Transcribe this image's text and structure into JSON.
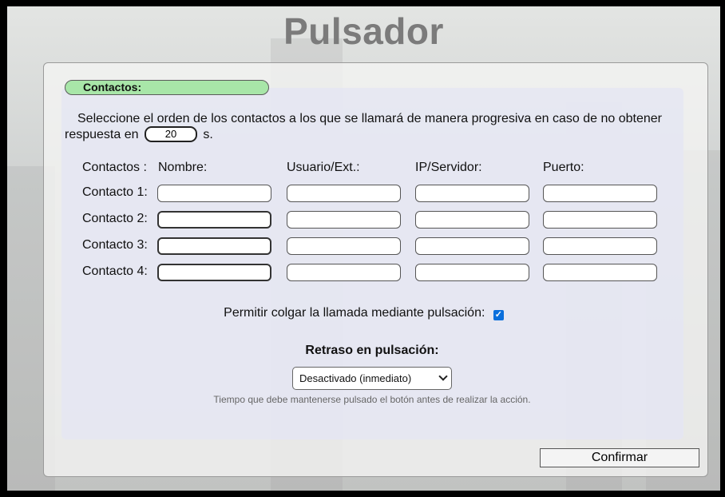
{
  "page": {
    "title": "Pulsador"
  },
  "contacts": {
    "section_label": "Contactos:",
    "intro_before": "Seleccione el orden de los contactos a los que se llamará de manera progresiva en caso de no obtener respuesta en",
    "timeout_value": "20",
    "intro_after": "s.",
    "headers": {
      "contacts": "Contactos :",
      "name": "Nombre:",
      "user": "Usuario/Ext.:",
      "server": "IP/Servidor:",
      "port": "Puerto:"
    },
    "rows": [
      {
        "label": "Contacto 1:",
        "name": "",
        "user": "",
        "server": "",
        "port": ""
      },
      {
        "label": "Contacto 2:",
        "name": "",
        "user": "",
        "server": "",
        "port": ""
      },
      {
        "label": "Contacto 3:",
        "name": "",
        "user": "",
        "server": "",
        "port": ""
      },
      {
        "label": "Contacto 4:",
        "name": "",
        "user": "",
        "server": "",
        "port": ""
      }
    ]
  },
  "hangup": {
    "label": "Permitir colgar la llamada mediante pulsación:",
    "checked": true
  },
  "delay": {
    "label": "Retraso en pulsación:",
    "selected": "Desactivado (inmediato)",
    "hint": "Tiempo que debe mantenerse pulsado el botón antes de realizar la acción."
  },
  "actions": {
    "confirm_label": "Confirmar"
  },
  "colors": {
    "section_pill": "#a8e6a8",
    "checkbox": "#0a6fdc",
    "title": "#7b7b7b"
  }
}
